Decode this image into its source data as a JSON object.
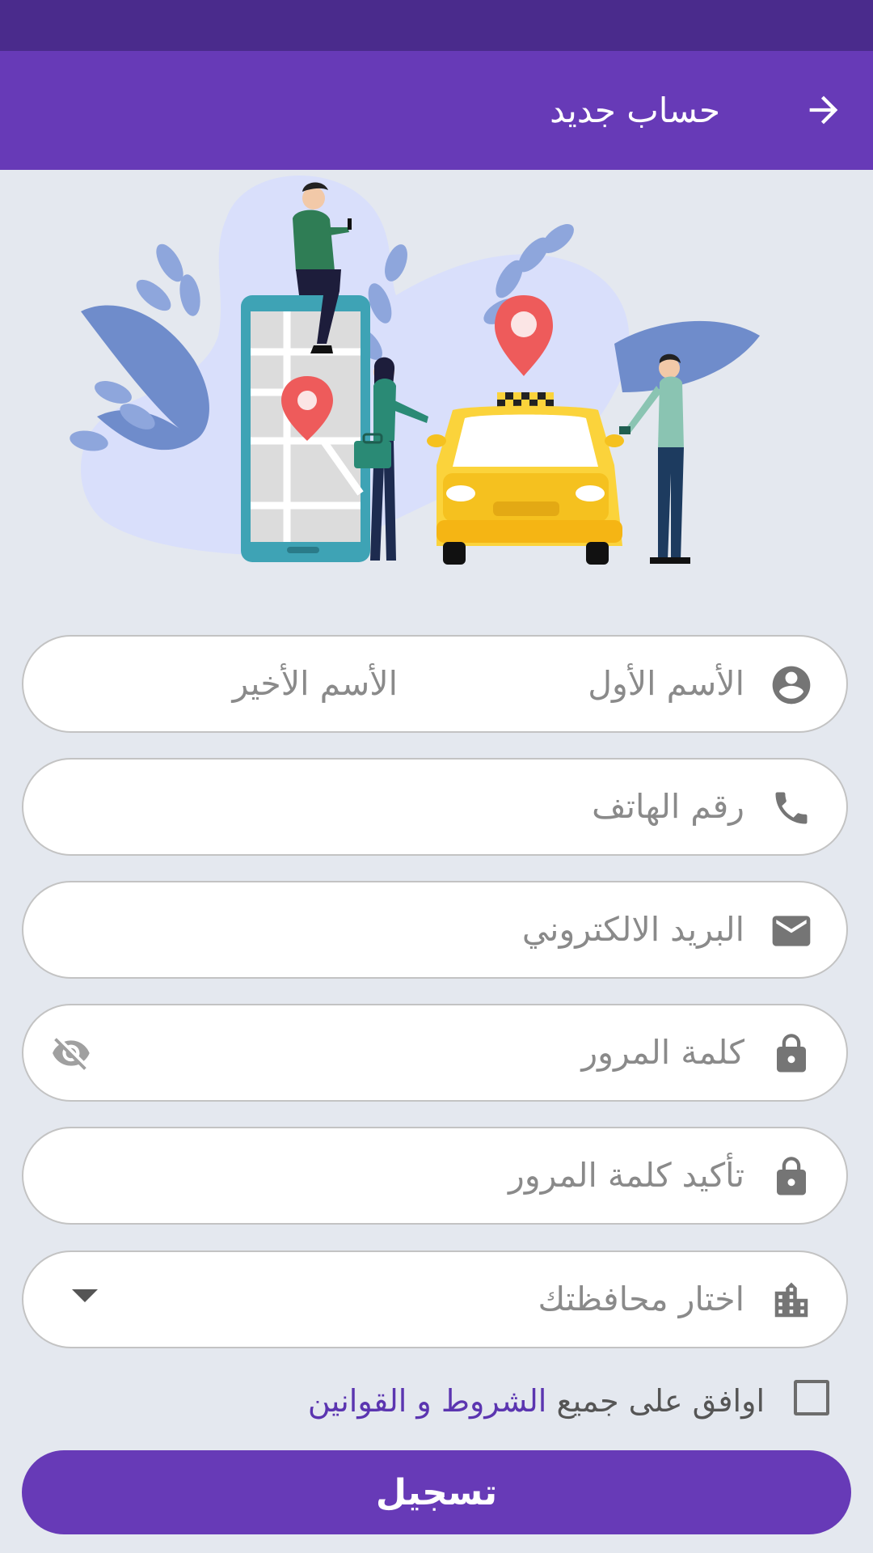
{
  "app_bar": {
    "title": "حساب جديد"
  },
  "form": {
    "first_name_placeholder": "الأسم الأول",
    "last_name_placeholder": "الأسم الأخير",
    "phone_placeholder": "رقم الهاتف",
    "email_placeholder": "البريد الالكتروني",
    "password_placeholder": "كلمة المرور",
    "confirm_password_placeholder": "تأكيد كلمة المرور",
    "governorate_placeholder": "اختار محافظتك"
  },
  "terms": {
    "prefix": "اوافق على جميع",
    "link": "الشروط و القوانين",
    "checked": false
  },
  "register_button": "تسجيل",
  "colors": {
    "primary": "#673ab7",
    "status_bar": "#4a2b8c",
    "background": "#e4e8ef",
    "taxi_yellow": "#fbd33b",
    "pin_red": "#ee5b5b"
  },
  "icons": {
    "back": "arrow-right-icon",
    "first_name": "account-circle-icon",
    "phone": "phone-icon",
    "email": "envelope-icon",
    "password": "lock-icon",
    "password_toggle": "eye-off-icon",
    "confirm_password": "lock-icon",
    "governorate": "city-icon",
    "dropdown": "caret-down-icon"
  }
}
